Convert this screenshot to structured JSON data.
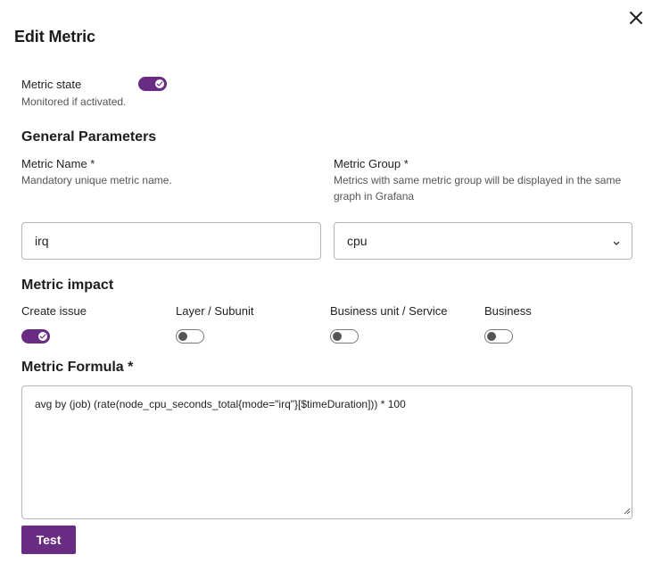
{
  "dialog": {
    "title": "Edit Metric",
    "close_icon": "close-icon"
  },
  "metric_state": {
    "label": "Metric state",
    "help": "Monitored if activated.",
    "enabled": true
  },
  "general": {
    "heading": "General Parameters",
    "name": {
      "label": "Metric Name *",
      "help": "Mandatory unique metric name.",
      "value": "irq"
    },
    "group": {
      "label": "Metric Group *",
      "help": "Metrics with same metric group will be displayed in the same graph in Grafana",
      "value": "cpu"
    }
  },
  "impact": {
    "heading": "Metric impact",
    "toggles": [
      {
        "label": "Create issue",
        "enabled": true
      },
      {
        "label": "Layer / Subunit",
        "enabled": false
      },
      {
        "label": "Business unit / Service",
        "enabled": false
      },
      {
        "label": "Business",
        "enabled": false
      }
    ]
  },
  "formula": {
    "heading": "Metric Formula *",
    "value": "avg by (job) (rate(node_cpu_seconds_total{mode=\"irq\"}[$timeDuration])) * 100"
  },
  "actions": {
    "test_label": "Test"
  },
  "colors": {
    "accent": "#6a2b83",
    "border": "#b5b5b5",
    "help_text": "#555555"
  }
}
